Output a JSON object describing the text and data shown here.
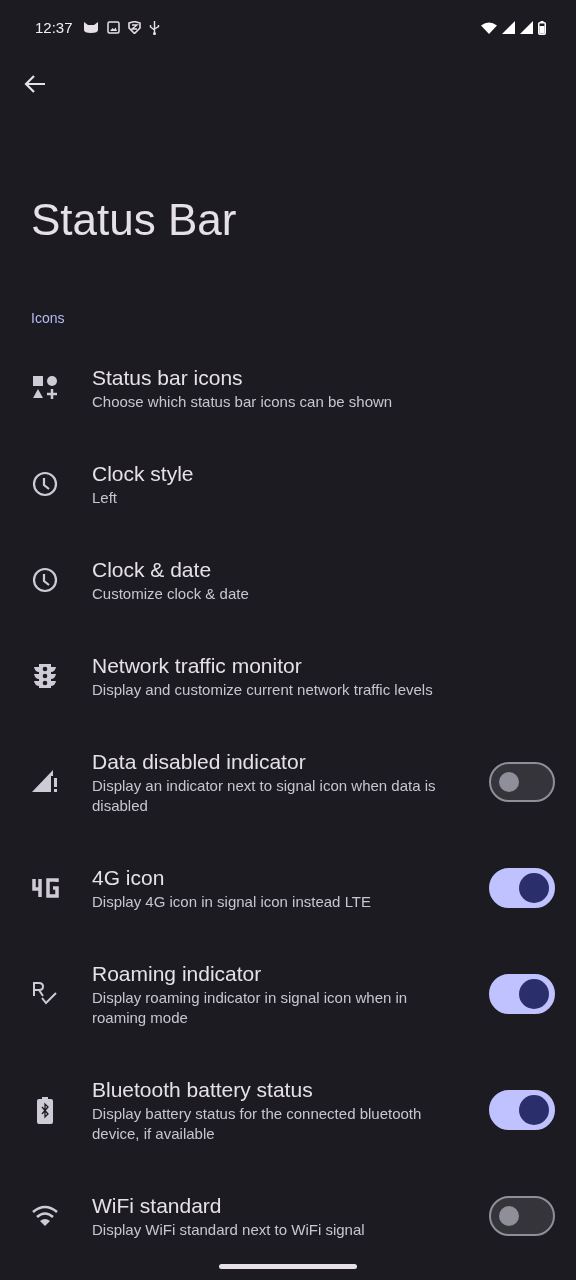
{
  "status_bar": {
    "time": "12:37"
  },
  "title": "Status Bar",
  "section": "Icons",
  "items": [
    {
      "kind": "link",
      "title": "Status bar icons",
      "summary": "Choose which status bar icons can be shown"
    },
    {
      "kind": "link",
      "title": "Clock style",
      "summary": "Left"
    },
    {
      "kind": "link",
      "title": "Clock & date",
      "summary": "Customize clock & date"
    },
    {
      "kind": "link",
      "title": "Network traffic monitor",
      "summary": "Display and customize current network traffic levels"
    },
    {
      "kind": "switch",
      "title": "Data disabled indicator",
      "summary": "Display an indicator next to signal icon when data is disabled",
      "on": false
    },
    {
      "kind": "switch",
      "title": "4G icon",
      "summary": "Display 4G icon in signal icon instead LTE",
      "on": true
    },
    {
      "kind": "switch",
      "title": "Roaming indicator",
      "summary": "Display roaming indicator in signal icon when in roaming mode",
      "on": true
    },
    {
      "kind": "switch",
      "title": "Bluetooth battery status",
      "summary": "Display battery status for the connected bluetooth device, if available",
      "on": true
    },
    {
      "kind": "switch",
      "title": "WiFi standard",
      "summary": "Display WiFi standard next to WiFi signal",
      "on": false
    }
  ]
}
